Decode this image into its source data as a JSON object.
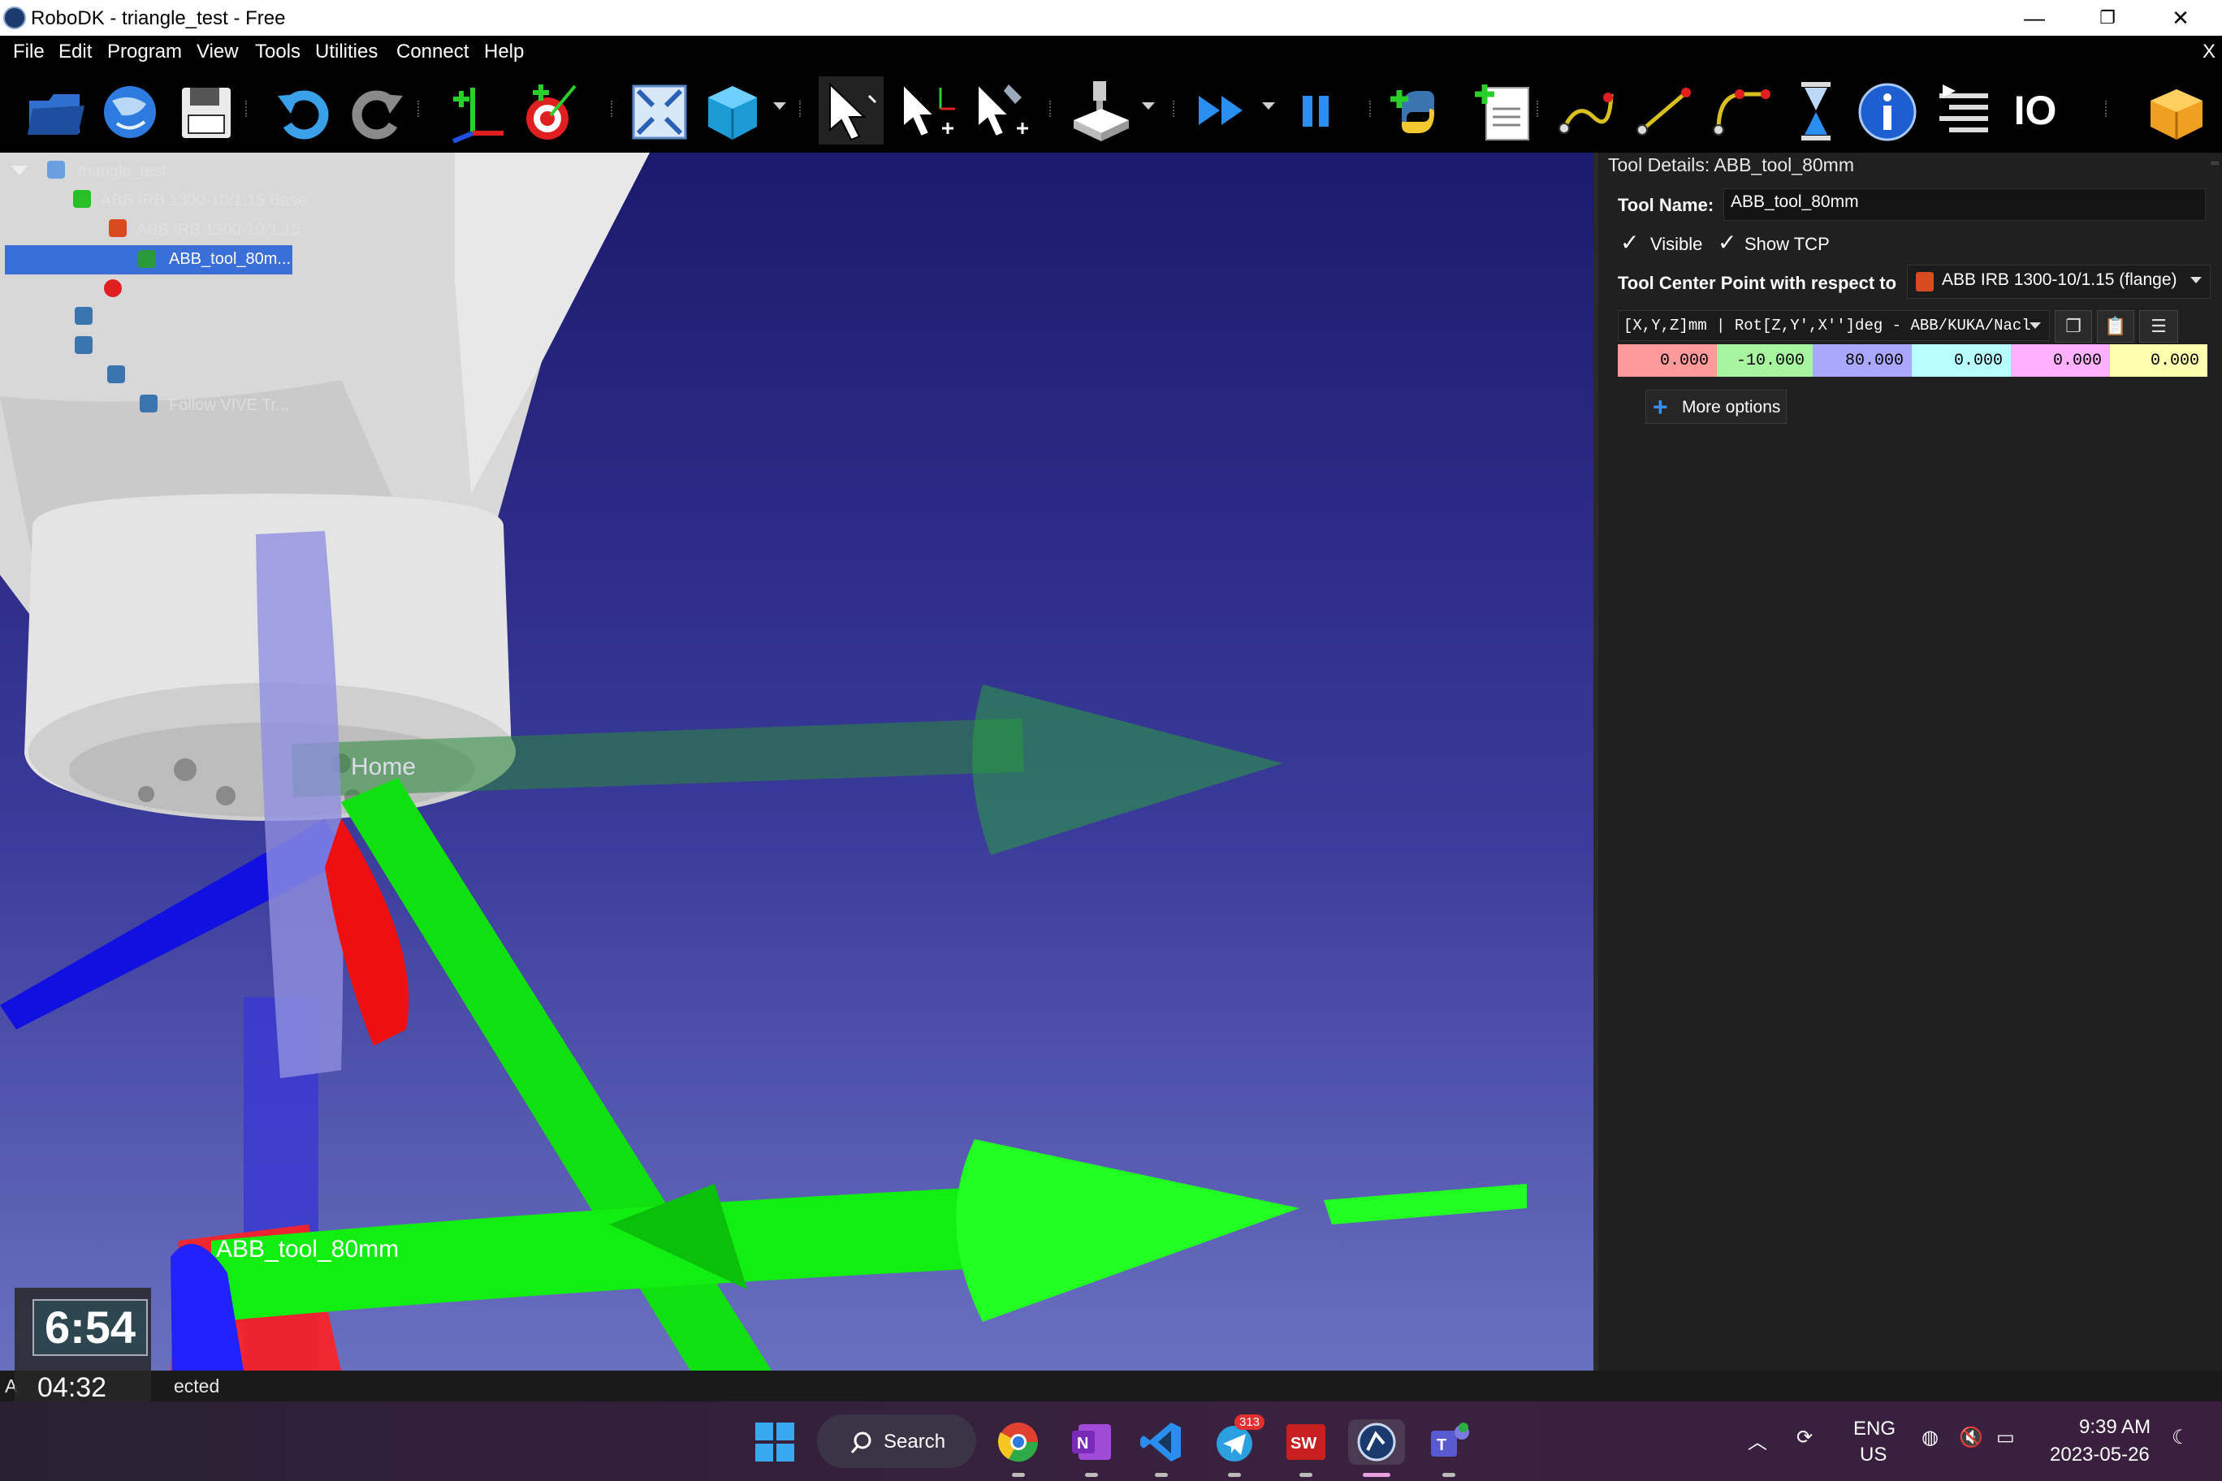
{
  "window": {
    "title": "RoboDK - triangle_test - Free",
    "minimize": "—",
    "maximize": "❐",
    "close": "✕"
  },
  "menu": {
    "items": [
      "File",
      "Edit",
      "Program",
      "View",
      "Tools",
      "Utilities",
      "Connect",
      "Help"
    ],
    "close_label": "X"
  },
  "toolbar": {
    "icons": [
      "open-station-icon",
      "open-online-library-icon",
      "save-station-icon",
      "undo-icon",
      "redo-icon",
      "add-reference-frame-icon",
      "add-target-icon",
      "fit-all-icon",
      "isometric-view-icon",
      "select-icon",
      "move-reference-frame-icon",
      "move-tool-icon",
      "add-cutting-tool-icon",
      "run-program-icon",
      "pause-icon",
      "add-python-program-icon",
      "add-program-icon",
      "move-joint-icon",
      "move-linear-icon",
      "move-circular-icon",
      "pause-instruction-icon",
      "info-icon",
      "program-call-icon",
      "io-icon",
      "add-on-box-icon"
    ],
    "io_label": "IO"
  },
  "tree": {
    "station": "triangle_test",
    "frame": "ABB IRB 1300-10/1.15 Base",
    "robot": "ABB IRB 1300-10/1.15",
    "tool": "ABB_tool_80m...",
    "program": "Follow VIVE Tr..."
  },
  "viewport": {
    "label_home": "Home",
    "label_tool": "ABB_tool_80mm",
    "colors": {
      "bg_top": "#1a1a6e",
      "bg_bottom": "#6a70c0",
      "axis_x": "#ff0000",
      "axis_y": "#00ff00",
      "axis_z": "#0000ff"
    }
  },
  "panel": {
    "header": "Tool Details: ABB_tool_80mm",
    "tool_name_label": "Tool Name:",
    "tool_name_value": "ABB_tool_80mm",
    "visible_label": "Visible",
    "show_tcp_label": "Show TCP",
    "tcp_label": "Tool Center Point with respect to",
    "tcp_ref": "ABB IRB 1300-10/1.15 (flange)",
    "format": "[X,Y,Z]mm | Rot[Z,Y',X'']deg - ABB/KUKA/Nacl",
    "values": [
      {
        "value": "0.000",
        "color": "#ff9a9a"
      },
      {
        "value": "-10.000",
        "color": "#a8f5a0"
      },
      {
        "value": "80.000",
        "color": "#a8a8ff"
      },
      {
        "value": "0.000",
        "color": "#b8ffff"
      },
      {
        "value": "0.000",
        "color": "#ffb0ff"
      },
      {
        "value": "0.000",
        "color": "#ffffb0"
      }
    ],
    "more_options": "More options"
  },
  "status": {
    "prefix": "A",
    "suffix": "ected"
  },
  "clock": {
    "timer": "6:54",
    "time": "04:32 PM"
  },
  "taskbar": {
    "search": "Search",
    "telegram_badge": "313",
    "lang_top": "ENG",
    "lang_bottom": "US",
    "time": "9:39 AM",
    "date": "2023-05-26"
  }
}
